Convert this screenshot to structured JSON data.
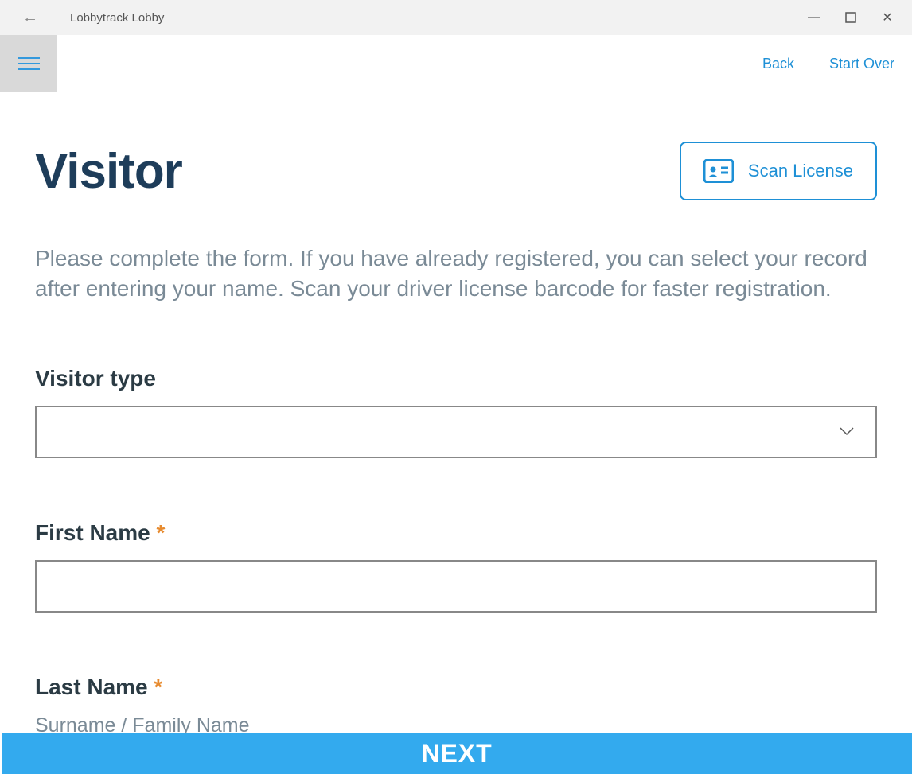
{
  "window": {
    "title": "Lobbytrack Lobby"
  },
  "header": {
    "back": "Back",
    "start_over": "Start Over"
  },
  "page": {
    "title": "Visitor",
    "scan_label": "Scan License",
    "instructions": "Please complete the form. If you have already registered, you can select your record after entering your your name. Scan your driver license barcode for faster registration."
  },
  "form": {
    "visitor_type": {
      "label": "Visitor type",
      "value": ""
    },
    "first_name": {
      "label": "First Name",
      "required_mark": "*",
      "value": ""
    },
    "last_name": {
      "label": "Last Name",
      "required_mark": "*",
      "helper": "Surname / Family Name"
    }
  },
  "footer": {
    "next": "NEXT"
  },
  "page_fixed": {
    "instructions": "Please complete the form. If you have already registered, you can select your record after entering your name. Scan your driver license barcode for faster registration."
  }
}
